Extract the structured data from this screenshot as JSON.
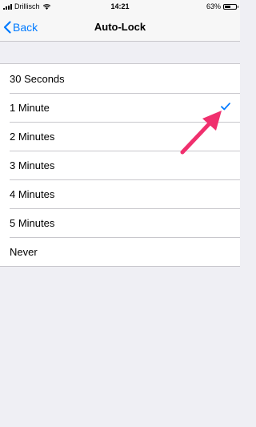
{
  "status_bar": {
    "carrier": "Drillisch",
    "time": "14:21",
    "battery_percent": "63%",
    "battery_level": 0.63,
    "icons": [
      "signal-icon",
      "wifi-icon",
      "battery-icon"
    ]
  },
  "nav": {
    "back_label": "Back",
    "title": "Auto-Lock",
    "back_icon": "chevron-left-icon"
  },
  "options": [
    {
      "label": "30 Seconds",
      "selected": false
    },
    {
      "label": "1 Minute",
      "selected": true
    },
    {
      "label": "2 Minutes",
      "selected": false
    },
    {
      "label": "3 Minutes",
      "selected": false
    },
    {
      "label": "4 Minutes",
      "selected": false
    },
    {
      "label": "5 Minutes",
      "selected": false
    },
    {
      "label": "Never",
      "selected": false
    }
  ],
  "annotation": {
    "icon": "pointer-arrow-icon"
  },
  "colors": {
    "accent": "#007aff",
    "background": "#efeff4",
    "arrow": "#f0306e"
  }
}
